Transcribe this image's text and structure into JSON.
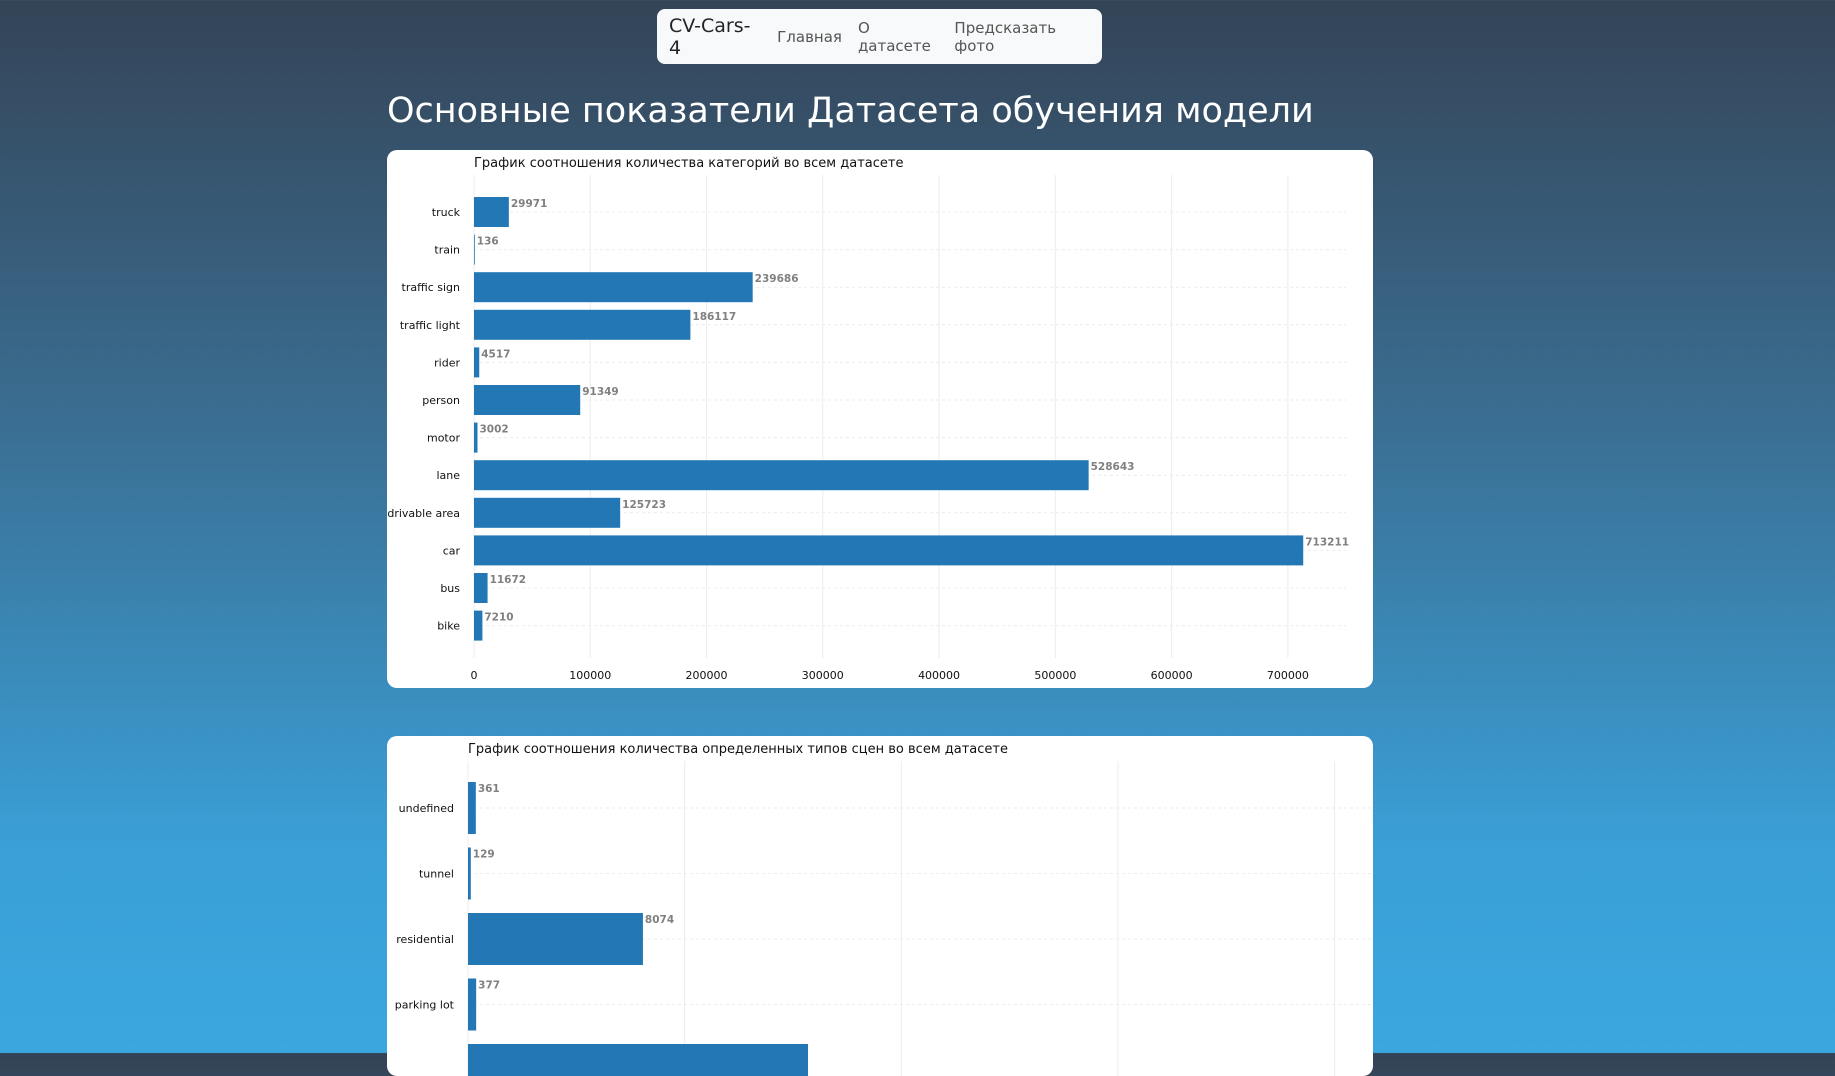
{
  "navbar": {
    "brand": "CV-Cars-4",
    "links": [
      "Главная",
      "О датасете",
      "Предсказать фото"
    ]
  },
  "page": {
    "title": "Основные показатели Датасета обучения модели"
  },
  "colors": {
    "bar": "#2277b4",
    "value_label": "#808080",
    "grid": "#ececec"
  },
  "chart_data": [
    {
      "type": "bar",
      "orientation": "horizontal",
      "title": "График соотношения количества категорий во всем датасете",
      "categories": [
        "truck",
        "train",
        "traffic sign",
        "traffic light",
        "rider",
        "person",
        "motor",
        "lane",
        "drivable area",
        "car",
        "bus",
        "bike"
      ],
      "values": [
        29971,
        136,
        239686,
        186117,
        4517,
        91349,
        3002,
        528643,
        125723,
        713211,
        11672,
        7210
      ],
      "xticks": [
        0,
        100000,
        200000,
        300000,
        400000,
        500000,
        600000,
        700000
      ],
      "xlim": [
        0,
        750000
      ],
      "grid": true,
      "data_labels": true
    },
    {
      "type": "bar",
      "orientation": "horizontal",
      "title": "График соотношения количества определенных типов сцен во всем датасете",
      "categories": [
        "undefined",
        "tunnel",
        "residential",
        "parking lot"
      ],
      "values": [
        361,
        129,
        8074,
        377
      ],
      "partially_visible_bar": true,
      "xlim": [
        0,
        45000
      ],
      "grid": true,
      "data_labels": true
    }
  ]
}
